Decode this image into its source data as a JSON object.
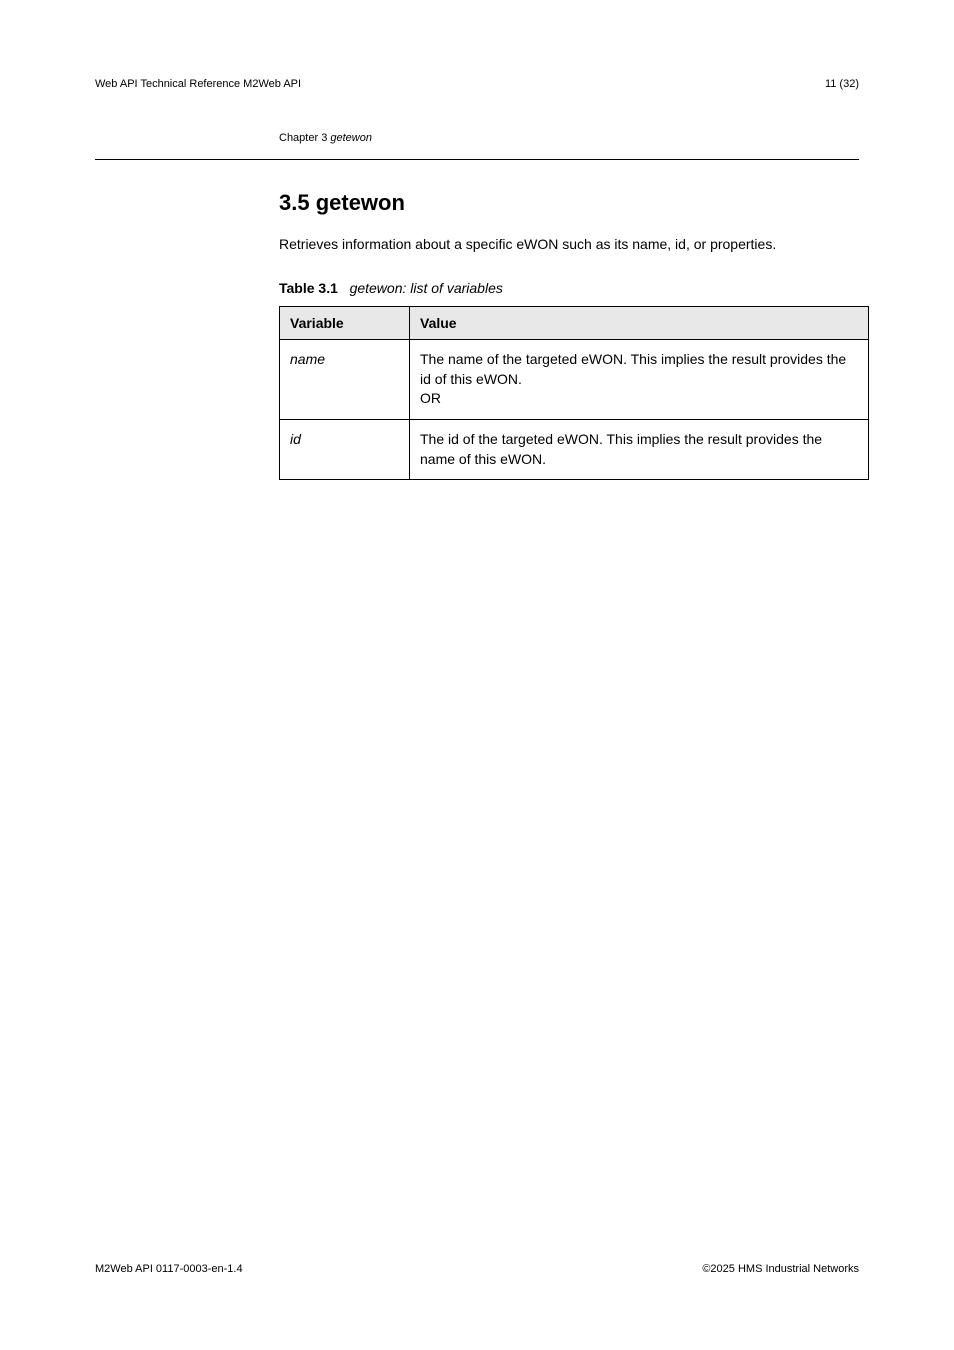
{
  "header": {
    "manual_name": "Web API Technical Reference  M2Web API",
    "page_heading_prefix": "Chapter 3",
    "page_heading_italic": "getewon"
  },
  "section": {
    "heading": "3.5 getewon",
    "intro": "Retrieves information about a specific eWON such as its name, id, or properties.",
    "table_caption_bold": "Table 3.1",
    "table_caption_italic": "getewon: list of variables",
    "table": {
      "head": [
        "Variable",
        "Value"
      ],
      "rows": [
        {
          "param": "name",
          "desc": "The name of the targeted eWON. This implies the result provides the id of this eWON.\nOR"
        },
        {
          "param": "id",
          "desc": "The id of the targeted eWON. This implies the result provides the name of this eWON."
        }
      ]
    }
  },
  "footer": {
    "doc_ref": "M2Web API  0117-0003-en-1.4",
    "copyright": "©2025 HMS Industrial Networks"
  }
}
